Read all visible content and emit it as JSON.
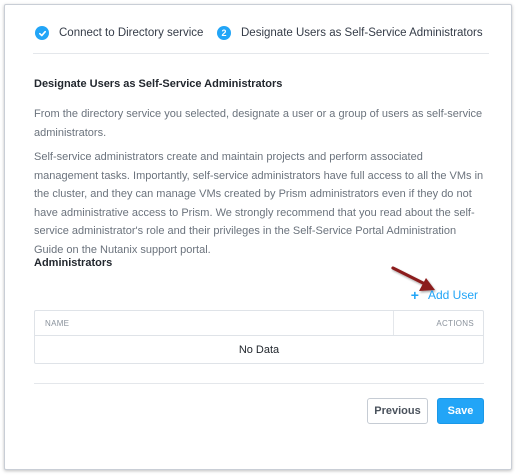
{
  "wizard": {
    "steps": [
      {
        "marker": "check",
        "label": "Connect to Directory service",
        "state": "completed"
      },
      {
        "marker": "2",
        "label": "Designate Users as Self-Service Administrators",
        "state": "active"
      }
    ]
  },
  "main": {
    "title": "Designate Users as Self-Service Administrators",
    "paragraph1": "From the directory service you selected, designate a user or a group of users as self-service administrators.",
    "paragraph2": "Self-service administrators create and maintain projects and perform associated management tasks. Importantly, self-service administrators have full access to all the VMs in the cluster, and they can manage VMs created by Prism administrators even if they do not have administrative access to Prism. We strongly recommend that you read about the self-service administrator's role and their privileges in the Self-Service Portal Administration Guide on the Nutanix support portal.",
    "administrators_label": "Administrators",
    "add_user_icon": "plus-icon",
    "add_user_label": "Add User",
    "table": {
      "columns": [
        "NAME",
        "ACTIONS"
      ],
      "empty_text": "No Data"
    }
  },
  "footer": {
    "previous_label": "Previous",
    "save_label": "Save"
  },
  "colors": {
    "accent": "#22a5f7",
    "annotation_arrow": "#8b1a1a"
  }
}
